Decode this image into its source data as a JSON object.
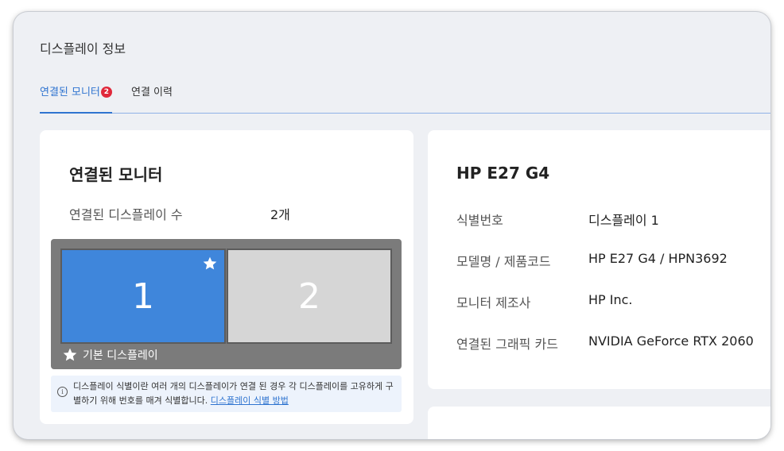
{
  "window": {
    "title": "디스플레이 정보"
  },
  "tabs": [
    {
      "label": "연결된 모니터",
      "badge": "2",
      "active": true
    },
    {
      "label": "연결 이력",
      "active": false
    }
  ],
  "connected": {
    "title": "연결된 모니터",
    "count_label": "연결된 디스플레이 수",
    "count_value": "2개",
    "monitors": [
      {
        "number": "1",
        "primary": true
      },
      {
        "number": "2",
        "primary": false
      }
    ],
    "primary_legend": "기본 디스플레이",
    "info_text": "디스플레이 식별이란 여러 개의 디스플레이가 연결 된 경우 각 디스플레이를 고유하게 구별하기 위해 번호를 매겨 식별합니다.",
    "info_link": "디스플레이 식별 방법"
  },
  "detail": {
    "title": "HP E27 G4",
    "rows": [
      {
        "label": "식별번호",
        "value": "디스플레이 1"
      },
      {
        "label": "모델명 / 제품코드",
        "value": "HP E27 G4 / HPN3692"
      },
      {
        "label": "모니터 제조사",
        "value": "HP Inc."
      },
      {
        "label": "연결된 그래픽 카드",
        "value": "NVIDIA GeForce RTX 2060"
      }
    ]
  },
  "colors": {
    "accent": "#2f74d0",
    "badge": "#e0283a",
    "primary_monitor": "#3f86db",
    "secondary_monitor": "#d6d6d6"
  }
}
